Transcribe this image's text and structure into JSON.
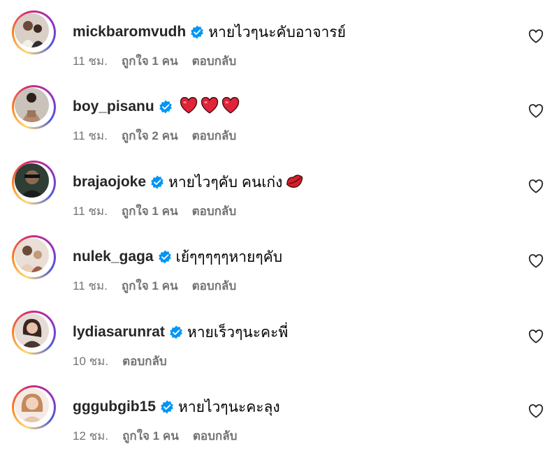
{
  "comments": [
    {
      "username": "mickbaromvudh",
      "text": "หายไวๆนะคับอาจารย์",
      "emoji": [],
      "time": "11 ชม.",
      "likes": "ถูกใจ 1 คน",
      "reply": "ตอบกลับ",
      "avatar_color": "#c7a68f"
    },
    {
      "username": "boy_pisanu",
      "text": "",
      "emoji": [
        "heart-emoji",
        "heart-emoji",
        "heart-emoji"
      ],
      "time": "11 ชม.",
      "likes": "ถูกใจ 2 คน",
      "reply": "ตอบกลับ",
      "avatar_color": "#a88b78"
    },
    {
      "username": "brajaojoke",
      "text": "หายไวๆคับ คนเก่ง",
      "emoji": [
        "kiss-lips-emoji"
      ],
      "time": "11 ชม.",
      "likes": "ถูกใจ 1 คน",
      "reply": "ตอบกลับ",
      "avatar_color": "#3a4a3f"
    },
    {
      "username": "nulek_gaga",
      "text": "เย้ๆๆๆๆๆหายๆคับ",
      "emoji": [],
      "time": "11 ชม.",
      "likes": "ถูกใจ 1 คน",
      "reply": "ตอบกลับ",
      "avatar_color": "#d8b7a3"
    },
    {
      "username": "lydiasarunrat",
      "text": "หายเร็วๆนะคะพี่",
      "emoji": [],
      "time": "10 ชม.",
      "likes": "",
      "reply": "ตอบกลับ",
      "avatar_color": "#5a4038"
    },
    {
      "username": "gggubgib15",
      "text": "หายไวๆนะคะลุง",
      "emoji": [],
      "time": "12 ชม.",
      "likes": "ถูกใจ 1 คน",
      "reply": "ตอบกลับ",
      "avatar_color": "#e2b9a0"
    }
  ],
  "colors": {
    "verified_blue": "#0095f6",
    "meta_gray": "#737373",
    "heart_red": "#e0245e"
  },
  "icons": {
    "verified": "verified-badge-icon",
    "like": "heart-outline-icon"
  }
}
